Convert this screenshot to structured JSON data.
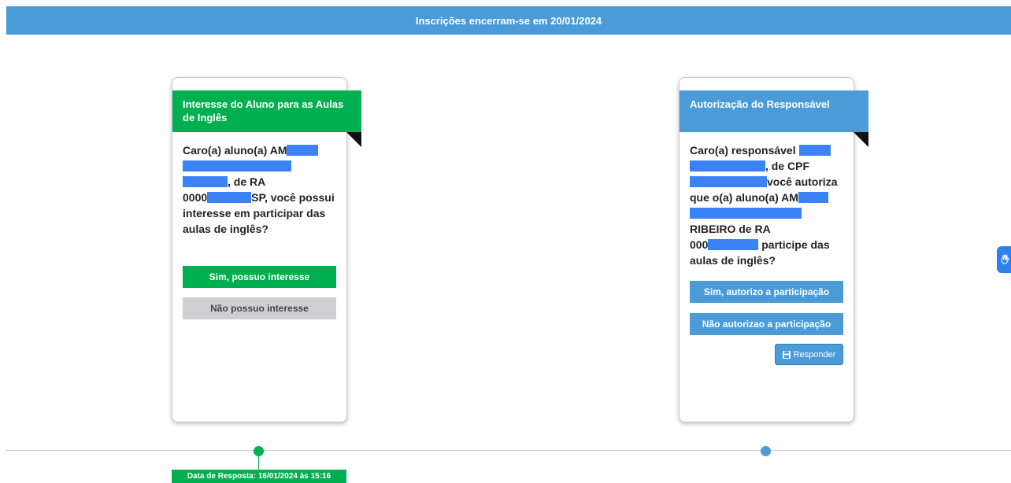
{
  "banner": {
    "text": "Inscrições encerram-se em 20/01/2024"
  },
  "student_card": {
    "title": "Interesse do Aluno para as Aulas de Inglês",
    "body": {
      "p1": "Caro(a) aluno(a) AM",
      "p2": ", de RA",
      "p3": "0000",
      "p4": "SP, você possui interesse em participar das aulas de inglês?"
    },
    "yes_label": "Sim, possuo interesse",
    "no_label": "Não possuo interesse"
  },
  "guardian_card": {
    "title": "Autorização do Responsável",
    "body": {
      "p1": "Caro(a) responsável",
      "p2": ", de CPF",
      "p3": "você autoriza que o(a) aluno(a) AM",
      "p4": "RIBEIRO de RA",
      "p5": "000",
      "p6": "participe das aulas de inglês?"
    },
    "yes_label": "Sim, autorizo a participação",
    "no_label": "Não autorizao a participação",
    "respond_label": "Responder"
  },
  "timeline": {
    "response_date": "Data de Resposta: 16/01/2024 às 15:16"
  },
  "colors": {
    "green": "#00b050",
    "blue": "#4a9bd8",
    "redaction": "#3b82f6"
  },
  "icons": {
    "respond": "floppy-disk-icon",
    "accessibility": "sign-language-icon"
  }
}
